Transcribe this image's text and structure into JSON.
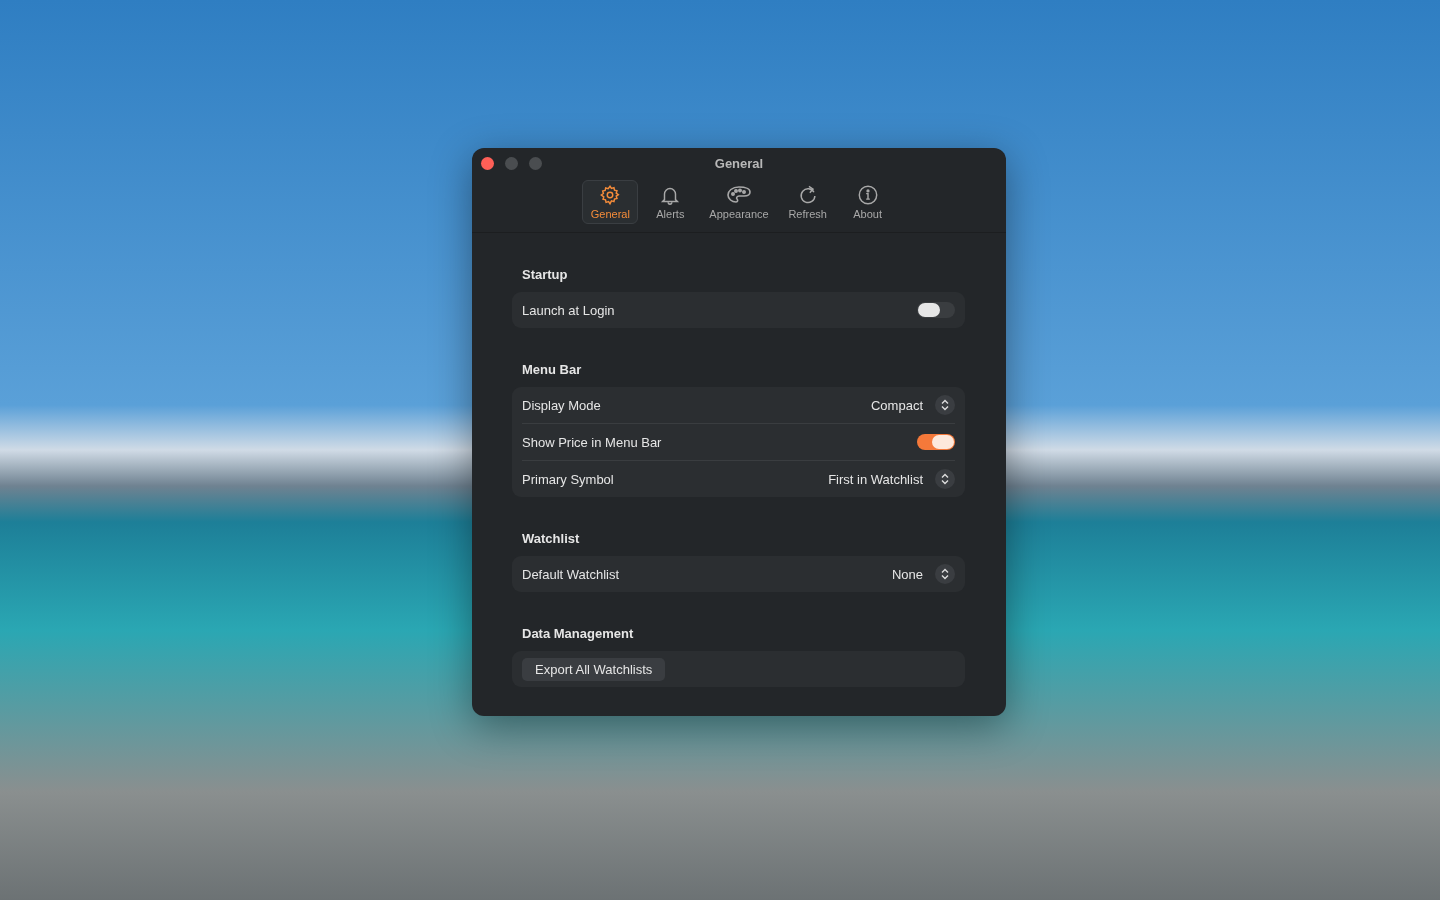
{
  "window": {
    "title": "General"
  },
  "tabs": [
    {
      "label": "General",
      "kind": "gear",
      "selected": true
    },
    {
      "label": "Alerts",
      "kind": "bell",
      "selected": false
    },
    {
      "label": "Appearance",
      "kind": "palette",
      "selected": false
    },
    {
      "label": "Refresh",
      "kind": "refresh",
      "selected": false
    },
    {
      "label": "About",
      "kind": "info",
      "selected": false
    }
  ],
  "sections": [
    {
      "title": "Startup",
      "rows": [
        {
          "kind": "toggle",
          "label": "Launch at Login",
          "on": false
        }
      ]
    },
    {
      "title": "Menu Bar",
      "rows": [
        {
          "kind": "select",
          "label": "Display Mode",
          "value": "Compact"
        },
        {
          "kind": "toggle",
          "label": "Show Price in Menu Bar",
          "on": true
        },
        {
          "kind": "select",
          "label": "Primary Symbol",
          "value": "First in Watchlist"
        }
      ]
    },
    {
      "title": "Watchlist",
      "rows": [
        {
          "kind": "select",
          "label": "Default Watchlist",
          "value": "None"
        }
      ]
    },
    {
      "title": "Data Management",
      "rows": [
        {
          "kind": "button",
          "label": "Export All Watchlists"
        }
      ]
    }
  ]
}
